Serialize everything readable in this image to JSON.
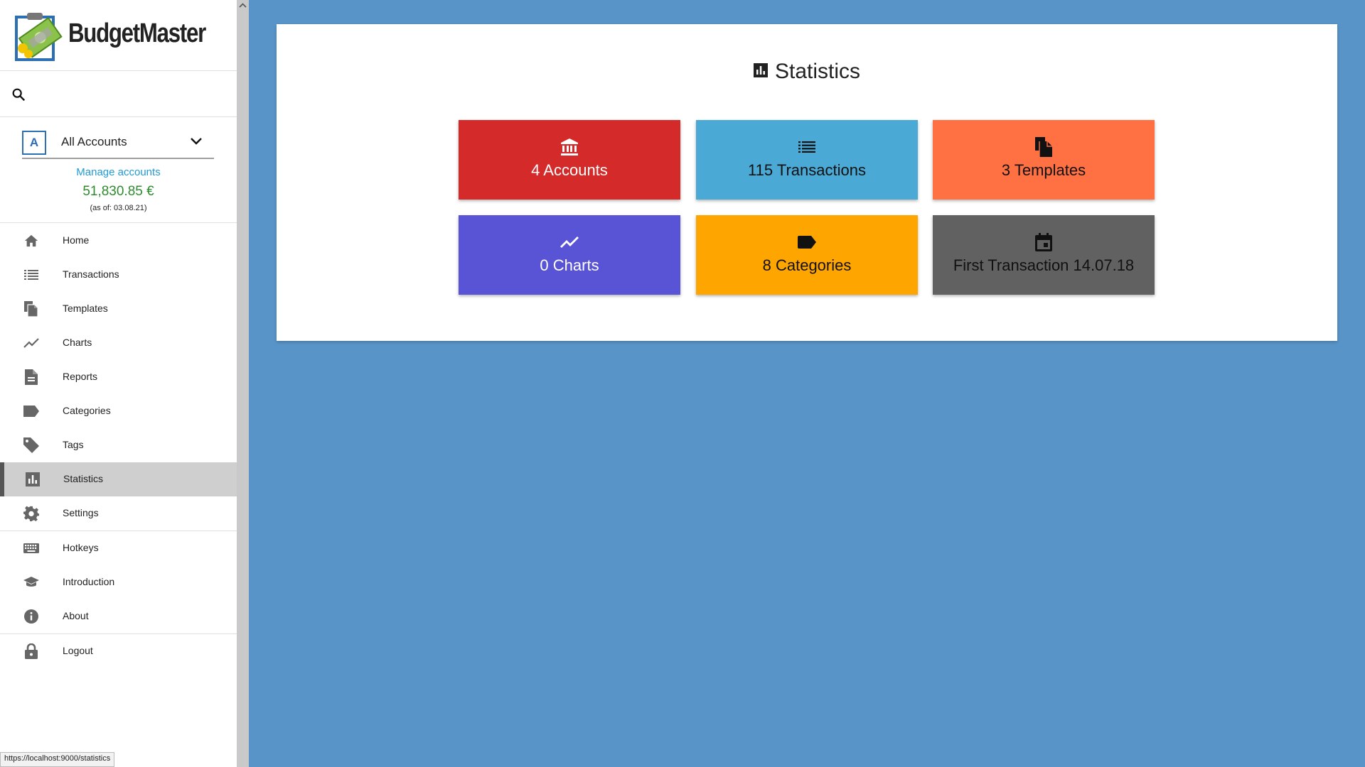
{
  "app": {
    "name": "BudgetMaster"
  },
  "search": {
    "placeholder": ""
  },
  "account": {
    "badge": "A",
    "selected": "All Accounts",
    "manage_label": "Manage accounts",
    "balance": "51,830.85 €",
    "as_of": "(as of: 03.08.21)"
  },
  "nav": {
    "items": [
      {
        "label": "Home",
        "icon": "home-icon"
      },
      {
        "label": "Transactions",
        "icon": "list-icon"
      },
      {
        "label": "Templates",
        "icon": "file-copy-icon"
      },
      {
        "label": "Charts",
        "icon": "trending-icon"
      },
      {
        "label": "Reports",
        "icon": "description-icon"
      },
      {
        "label": "Categories",
        "icon": "label-icon"
      },
      {
        "label": "Tags",
        "icon": "tag-icon"
      },
      {
        "label": "Statistics",
        "icon": "bar-chart-icon",
        "active": true
      },
      {
        "label": "Settings",
        "icon": "gear-icon"
      },
      {
        "label": "Hotkeys",
        "icon": "keyboard-icon"
      },
      {
        "label": "Introduction",
        "icon": "school-icon"
      },
      {
        "label": "About",
        "icon": "info-icon"
      },
      {
        "label": "Logout",
        "icon": "lock-icon"
      }
    ]
  },
  "status_url": "https://localhost:9000/statistics",
  "main": {
    "title": "Statistics",
    "tiles": [
      {
        "label": "4 Accounts",
        "icon": "bank-icon",
        "color": "#d52a2a",
        "text_color": "#ffffff"
      },
      {
        "label": "115 Transactions",
        "icon": "list-icon",
        "color": "#4aa9d5",
        "text_color": "#111111"
      },
      {
        "label": "3 Templates",
        "icon": "file-copy-icon",
        "color": "#ff7043",
        "text_color": "#111111"
      },
      {
        "label": "0 Charts",
        "icon": "trending-icon",
        "color": "#5954d6",
        "text_color": "#ffffff"
      },
      {
        "label": "8 Categories",
        "icon": "label-icon",
        "color": "#ffa500",
        "text_color": "#111111"
      },
      {
        "label": "First Transaction 14.07.18",
        "icon": "calendar-icon",
        "color": "#616161",
        "text_color": "#111111"
      }
    ]
  }
}
